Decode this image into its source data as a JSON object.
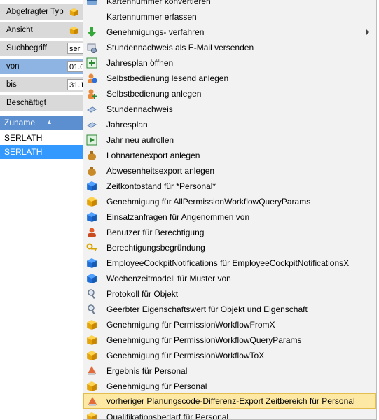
{
  "filter_panel": {
    "rows": [
      {
        "label": "Abgefragter Typ",
        "value": null,
        "icon": "cube-icon"
      },
      {
        "label": "Ansicht",
        "value": null,
        "icon": "cube-icon"
      },
      {
        "label": "Suchbegriff",
        "value": "serl",
        "icon": null
      },
      {
        "label": "von",
        "value": "01.0",
        "icon": null
      },
      {
        "label": "bis",
        "value": "31.1",
        "icon": null
      },
      {
        "label": "Beschäftigt",
        "value": null,
        "icon": null
      }
    ]
  },
  "grid": {
    "column_header": "Zuname",
    "sort_indicator": "▲",
    "rows": [
      "SERLATH",
      "SERLATH"
    ]
  },
  "context_menu": {
    "items": [
      {
        "label": "Kartennummer konvertieren",
        "icon": "card-icon"
      },
      {
        "label": "Kartennummer erfassen",
        "icon": "card-icon"
      },
      {
        "label": "Genehmigungs- verfahren",
        "icon": "green-down-arrow-icon",
        "submenu": true
      },
      {
        "label": "Stundennachweis als E-Mail versenden",
        "icon": "email-report-icon"
      },
      {
        "label": "Jahresplan öffnen",
        "icon": "calendar-plus-icon"
      },
      {
        "label": "Selbstbedienung lesend anlegen",
        "icon": "user-info-icon"
      },
      {
        "label": "Selbstbedienung anlegen",
        "icon": "user-add-icon"
      },
      {
        "label": "Stundennachweis",
        "icon": "document-icon"
      },
      {
        "label": "Jahresplan",
        "icon": "document-icon"
      },
      {
        "label": "Jahr neu aufrollen",
        "icon": "play-icon"
      },
      {
        "label": "Lohnartenexport anlegen",
        "icon": "money-bag-icon"
      },
      {
        "label": "Abwesenheitsexport anlegen",
        "icon": "money-bag-icon"
      },
      {
        "label": "Zeitkontostand für *Personal*",
        "icon": "blue-cube-icon"
      },
      {
        "label": "Genehmigung für AllPermissionWorkflowQueryParams",
        "icon": "yellow-cube-icon"
      },
      {
        "label": "Einsatzanfragen für Angenommen von",
        "icon": "blue-cube-icon"
      },
      {
        "label": "Benutzer für Berechtigung",
        "icon": "user-icon"
      },
      {
        "label": "Berechtigungsbegründung",
        "icon": "key-icon"
      },
      {
        "label": "EmployeeCockpitNotifications für EmployeeCockpitNotificationsX",
        "icon": "blue-cube-icon"
      },
      {
        "label": "Wochenzeitmodell für Muster von",
        "icon": "blue-cube-icon"
      },
      {
        "label": "Protokoll für Objekt",
        "icon": "magnifier-icon"
      },
      {
        "label": "Geerbter Eigenschaftswert für Objekt und Eigenschaft",
        "icon": "magnifier-icon"
      },
      {
        "label": "Genehmigung für PermissionWorkflowFromX",
        "icon": "yellow-cube-icon"
      },
      {
        "label": "Genehmigung für PermissionWorkflowQueryParams",
        "icon": "yellow-cube-icon"
      },
      {
        "label": "Genehmigung für PermissionWorkflowToX",
        "icon": "yellow-cube-icon"
      },
      {
        "label": "Ergebnis für Personal",
        "icon": "result-flag-icon"
      },
      {
        "label": "Genehmigung für Personal",
        "icon": "yellow-cube-icon"
      },
      {
        "label": "vorheriger Planungscode-Differenz-Export Zeitbereich für Personal",
        "icon": "result-flag-icon",
        "highlighted": true
      },
      {
        "label": "Qualifikationsbedarf für Personal",
        "icon": "yellow-cube-icon"
      }
    ]
  }
}
